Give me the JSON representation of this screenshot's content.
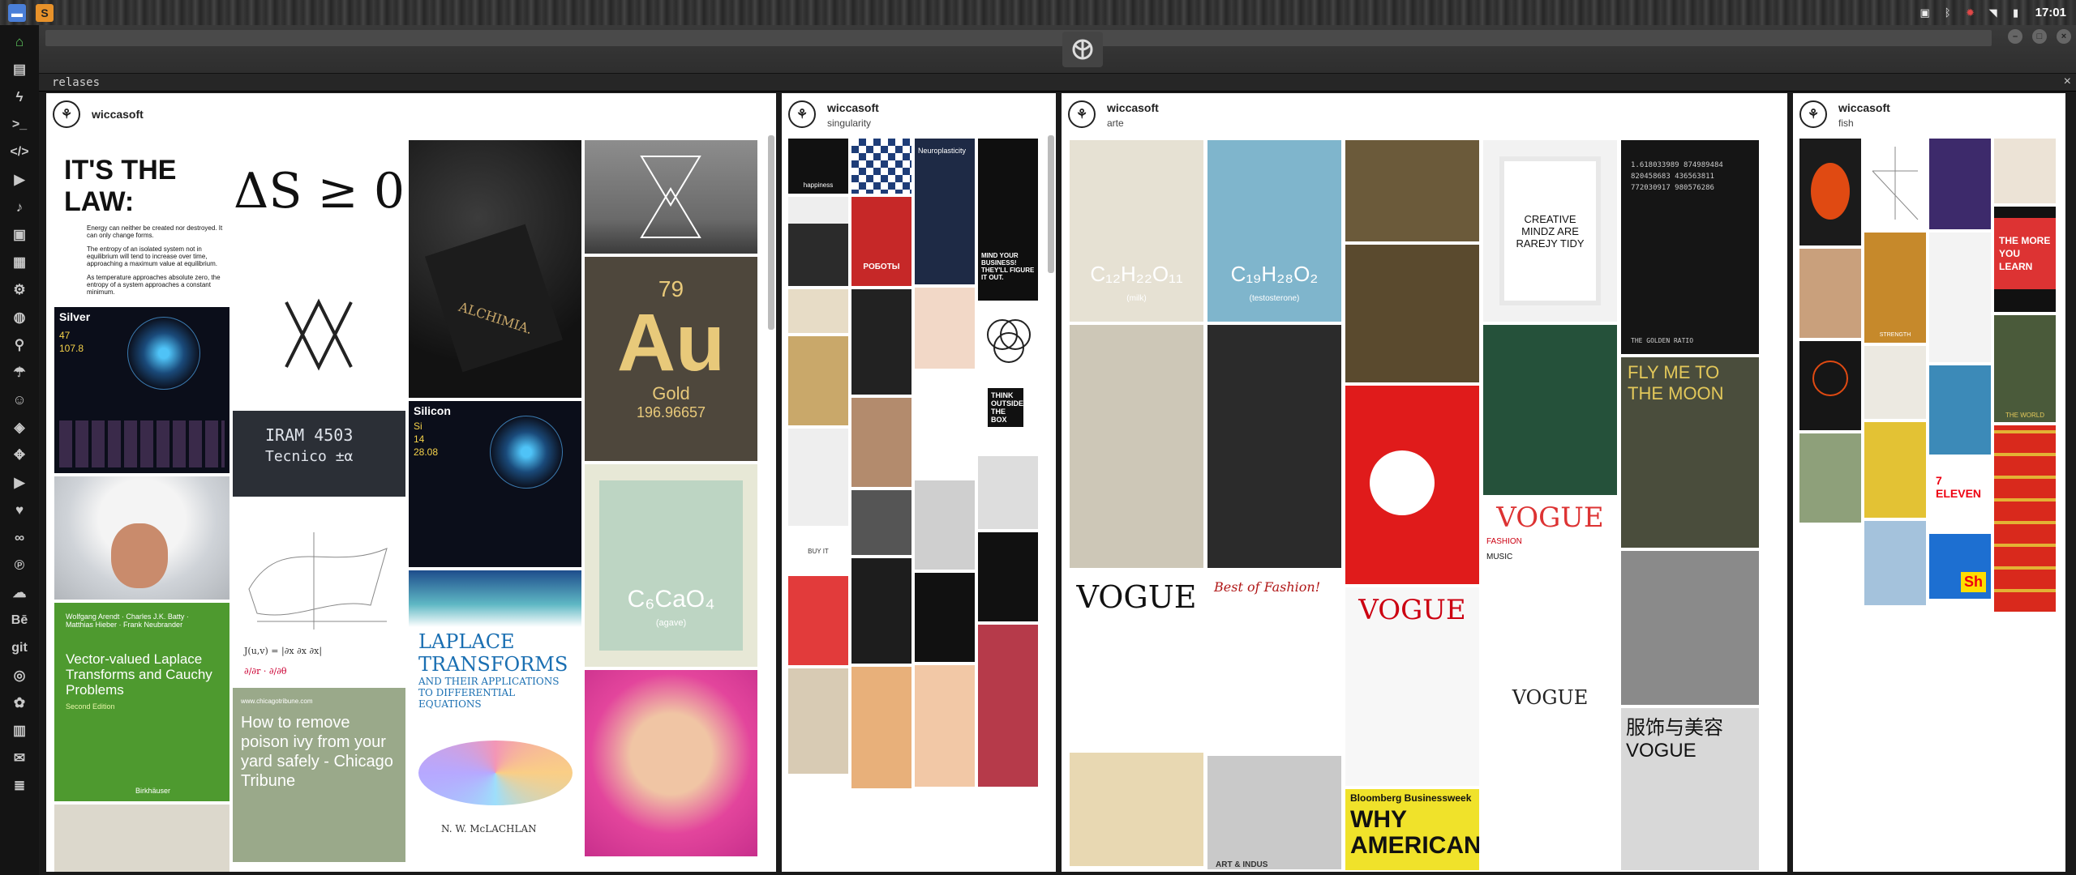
{
  "system": {
    "clock": "17:01",
    "tray_icons": [
      "image-icon",
      "bluetooth-icon",
      "alert-icon",
      "wifi-icon",
      "battery-icon"
    ]
  },
  "dock": {
    "items": [
      {
        "name": "home-icon",
        "glyph": "⌂"
      },
      {
        "name": "document-icon",
        "glyph": "▤"
      },
      {
        "name": "bolt-icon",
        "glyph": "ϟ"
      },
      {
        "name": "terminal-icon",
        "glyph": ">_"
      },
      {
        "name": "code-icon",
        "glyph": "</>"
      },
      {
        "name": "play-icon",
        "glyph": "▶"
      },
      {
        "name": "music-icon",
        "glyph": "♪"
      },
      {
        "name": "image-icon",
        "glyph": "▣"
      },
      {
        "name": "contacts-icon",
        "glyph": "▦"
      },
      {
        "name": "settings-icon",
        "glyph": "⚙"
      },
      {
        "name": "globe-icon",
        "glyph": "◍"
      },
      {
        "name": "search-icon",
        "glyph": "⚲"
      },
      {
        "name": "umbrella-icon",
        "glyph": "☂"
      },
      {
        "name": "person-icon",
        "glyph": "☺"
      },
      {
        "name": "tag-icon",
        "glyph": "◈"
      },
      {
        "name": "expand-icon",
        "glyph": "✥"
      },
      {
        "name": "youtube-icon",
        "glyph": "▶"
      },
      {
        "name": "heart-icon",
        "glyph": "♥"
      },
      {
        "name": "link-icon",
        "glyph": "∞"
      },
      {
        "name": "pinterest-icon",
        "glyph": "℗"
      },
      {
        "name": "cloud-icon",
        "glyph": "☁"
      },
      {
        "name": "behance-icon",
        "glyph": "Bē"
      },
      {
        "name": "git-icon",
        "glyph": "git"
      },
      {
        "name": "github-icon",
        "glyph": "◎"
      },
      {
        "name": "cluster-icon",
        "glyph": "✿"
      },
      {
        "name": "map-icon",
        "glyph": "▥"
      },
      {
        "name": "mail-icon",
        "glyph": "✉"
      },
      {
        "name": "storage-icon",
        "glyph": "≣"
      }
    ]
  },
  "window": {
    "title": "relases"
  },
  "columns": [
    {
      "username": "wiccasoft",
      "board": "",
      "texts": {
        "law_title": "IT'S THE LAW:",
        "law_1": "Energy can neither be created nor destroyed. It can only change forms.",
        "law_2": "The entropy of an isolated system not in equilibrium will tend to increase over time, approaching a maximum value at equilibrium.",
        "law_3": "As temperature approaches absolute zero, the entropy of a system approaches a constant minimum.",
        "entropy": "ΔS ≥ 0",
        "silver_name": "Silver",
        "silver_num": "47",
        "silver_mass": "107.8",
        "iram": "IRAM 4503",
        "tecnico": "Tecnico ±α",
        "alchimia": "ALCHIMIA.",
        "silicon_name": "Silicon",
        "silicon_sym": "Si",
        "silicon_num": "14",
        "silicon_mass": "28.08",
        "gold_num": "79",
        "gold_sym": "Au",
        "gold_name": "Gold",
        "gold_mass": "196.96657",
        "caffeine": "C₆CaO₄",
        "agave": "(agave)",
        "laplace_1": "LAPLACE",
        "laplace_2": "TRANSFORMS",
        "laplace_3": "AND THEIR APPLICATIONS",
        "laplace_4": "TO DIFFERENTIAL",
        "laplace_5": "EQUATIONS",
        "laplace_author": "N. W. McLACHLAN",
        "vv_title": "Vector-valued Laplace Transforms and Cauchy Problems",
        "vv_authors": "Wolfgang Arendt · Charles J.K. Batty · Matthias Hieber · Frank Neubrander",
        "vv_edition": "Second Edition",
        "vv_pub": "Birkhäuser",
        "poison": "How to remove poison ivy from your yard safely - Chicago Tribune",
        "poison_url": "www.chicagotribune.com"
      }
    },
    {
      "username": "wiccasoft",
      "board": "singularity",
      "texts": {
        "happiness": "happiness",
        "neuro": "Neuroplasticity",
        "roboty": "РОБОТЫ",
        "mind": "MIND YOUR BUSINESS! THEY'LL FIGURE IT OUT.",
        "think": "THINK OUTSIDE THE BOX",
        "buy": "BUY IT",
        "out": "OUT"
      }
    },
    {
      "username": "wiccasoft",
      "board": "arte",
      "texts": {
        "milk": "C₁₂H₂₂O₁₁",
        "milk_sub": "(milk)",
        "test": "C₁₉H₂₈O₂",
        "test_sub": "(testosterone)",
        "creative": "CREATIVE MINDZ ARE RAREJY TIDY",
        "golden": "THE GOLDEN RATIO",
        "vogue": "VOGUE",
        "best": "Best of Fashion!",
        "fly": "FLY ME TO THE MOON",
        "bloomberg": "Bloomberg Businessweek",
        "why": "WHY AMERICANS",
        "art": "ART & INDUS",
        "fashion": "FASHION",
        "music": "MUSIC",
        "vogue_cn": "服饰与美容 VOGUE"
      }
    },
    {
      "username": "wiccasoft",
      "board": "fish",
      "texts": {
        "strength": "STRENGTH",
        "world": "THE WORLD",
        "more": "THE MORE YOU LEARN",
        "eleven": "7 ELEVEN",
        "shell": "Sh"
      }
    }
  ]
}
